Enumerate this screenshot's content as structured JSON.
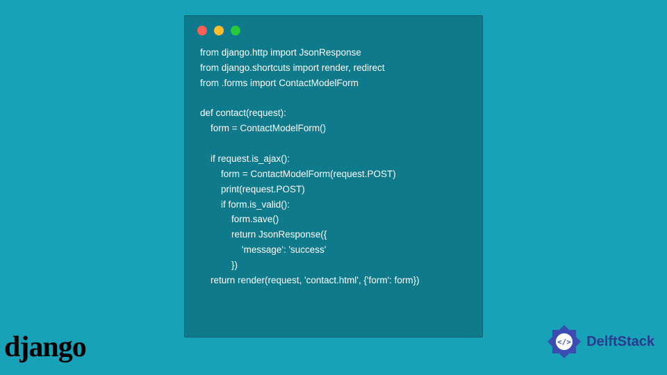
{
  "code": {
    "lines": [
      "from django.http import JsonResponse",
      "from django.shortcuts import render, redirect",
      "from .forms import ContactModelForm",
      "",
      "def contact(request):",
      "    form = ContactModelForm()",
      "",
      "    if request.is_ajax():",
      "        form = ContactModelForm(request.POST)",
      "        print(request.POST)",
      "        if form.is_valid():",
      "            form.save()",
      "            return JsonResponse({",
      "                'message': 'success'",
      "            })",
      "    return render(request, 'contact.html', {'form': form})"
    ]
  },
  "window": {
    "dots": {
      "red": "#ff5f56",
      "yellow": "#ffbd2e",
      "green": "#27c93f"
    }
  },
  "logos": {
    "django": "django",
    "delftstack": "DelftStack"
  },
  "colors": {
    "page_bg": "#17a2b8",
    "window_bg": "#0e7a8c",
    "code_text": "#ffffff",
    "django_text": "#000000",
    "delftstack_text": "#2b3a8f",
    "delftstack_icon": "#3b4db0"
  }
}
